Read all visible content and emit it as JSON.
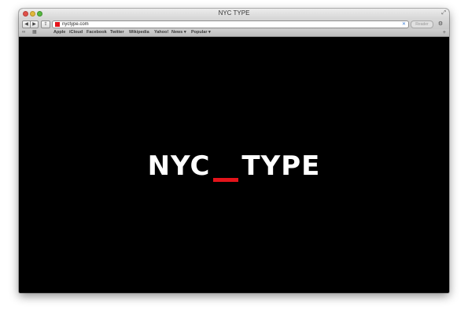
{
  "window": {
    "title": "NYC TYPE"
  },
  "toolbar": {
    "back_label": "◀",
    "forward_label": "▶",
    "share_label": "⇪",
    "url": "nyctype.com",
    "reader_label": "Reader",
    "clear_label": "✕",
    "settings_label": "⚙"
  },
  "bookmarks": {
    "items": [
      "Apple",
      "iCloud",
      "Facebook",
      "Twitter",
      "Wikipedia",
      "Yahoo!",
      "News ▾",
      "Popular ▾"
    ]
  },
  "page": {
    "logo_left": "NYC",
    "logo_right": "TYPE",
    "accent_color": "#e4141b"
  },
  "icons": {
    "reading_list": "reading-list-icon",
    "top_sites": "top-sites-icon",
    "add_tab": "add-tab-icon",
    "fullscreen": "fullscreen-icon"
  }
}
